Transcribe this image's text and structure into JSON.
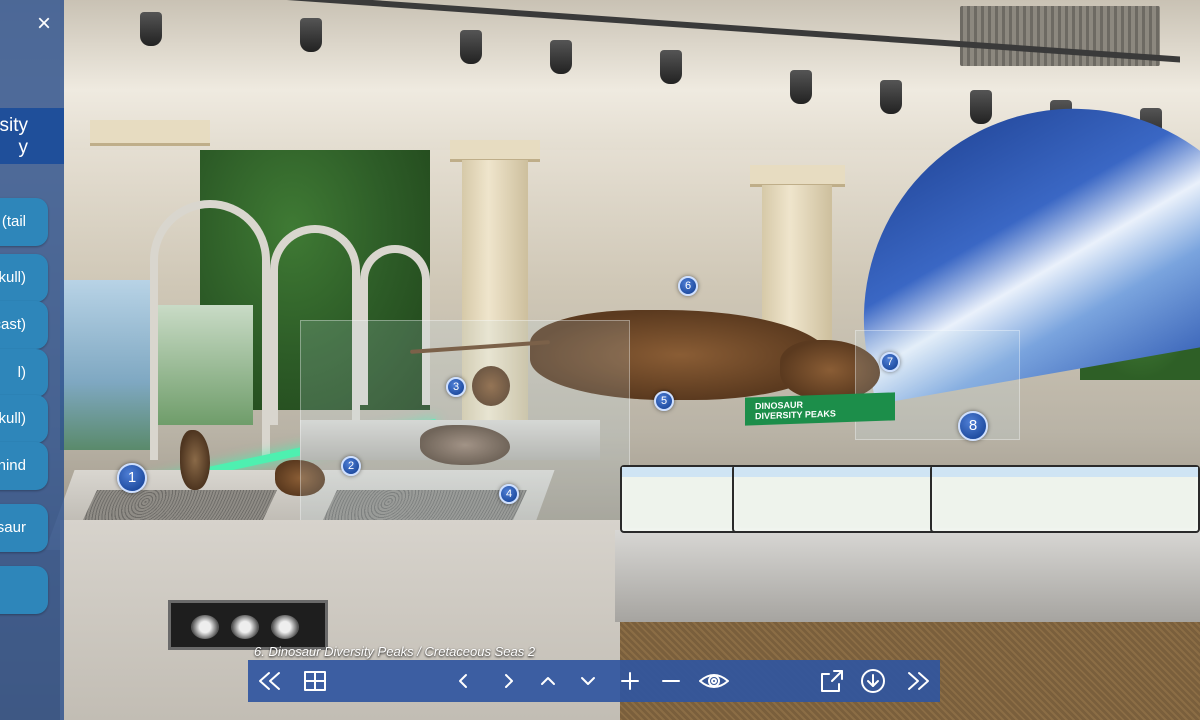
{
  "caption": "6. Dinosaur Diversity Peaks / Cretaceous Seas 2",
  "sidebar": {
    "close_label": "×",
    "title_lines": [
      "sity",
      "y"
    ],
    "items": [
      {
        "line1": "(tail",
        "line2": ""
      },
      {
        "line1": "kull)",
        "line2": ""
      },
      {
        "line1": "(cast)",
        "line2": ""
      },
      {
        "line1": "l)",
        "line2": ""
      },
      {
        "line1": "kull)",
        "line2": ""
      },
      {
        "line1": "r (hind",
        "line2": ""
      },
      {
        "line1": "nosaur",
        "line2": ""
      },
      {
        "line1": "",
        "line2": ""
      }
    ]
  },
  "exhibit_sign": {
    "line1": "DINOSAUR",
    "line2": "DIVERSITY PEAKS"
  },
  "hotspots": [
    "1",
    "2",
    "3",
    "4",
    "5",
    "6",
    "7",
    "8"
  ],
  "toolbar": {
    "buttons": [
      {
        "name": "rewind",
        "icon": "double-chevron-left-icon"
      },
      {
        "name": "thumbnails",
        "icon": "grid-icon"
      },
      {
        "name": "pan-left",
        "icon": "chevron-left-icon"
      },
      {
        "name": "pan-right",
        "icon": "chevron-right-icon"
      },
      {
        "name": "pan-up",
        "icon": "chevron-up-icon"
      },
      {
        "name": "pan-down",
        "icon": "chevron-down-icon"
      },
      {
        "name": "zoom-in",
        "icon": "plus-icon"
      },
      {
        "name": "zoom-out",
        "icon": "minus-icon"
      },
      {
        "name": "view-mode",
        "icon": "eye-icon"
      },
      {
        "name": "fullscreen",
        "icon": "expand-icon"
      },
      {
        "name": "download",
        "icon": "arrow-down-circle-icon"
      },
      {
        "name": "fast-forward",
        "icon": "double-chevron-right-icon"
      }
    ]
  },
  "colors": {
    "toolbar_bg": "#3056a0",
    "sidebar_bg": "#2d508c",
    "sidebar_item_bg": "#2e86ba",
    "hotspot_bg": "#0e3a8d",
    "sign_green": "#1c8e4a"
  }
}
